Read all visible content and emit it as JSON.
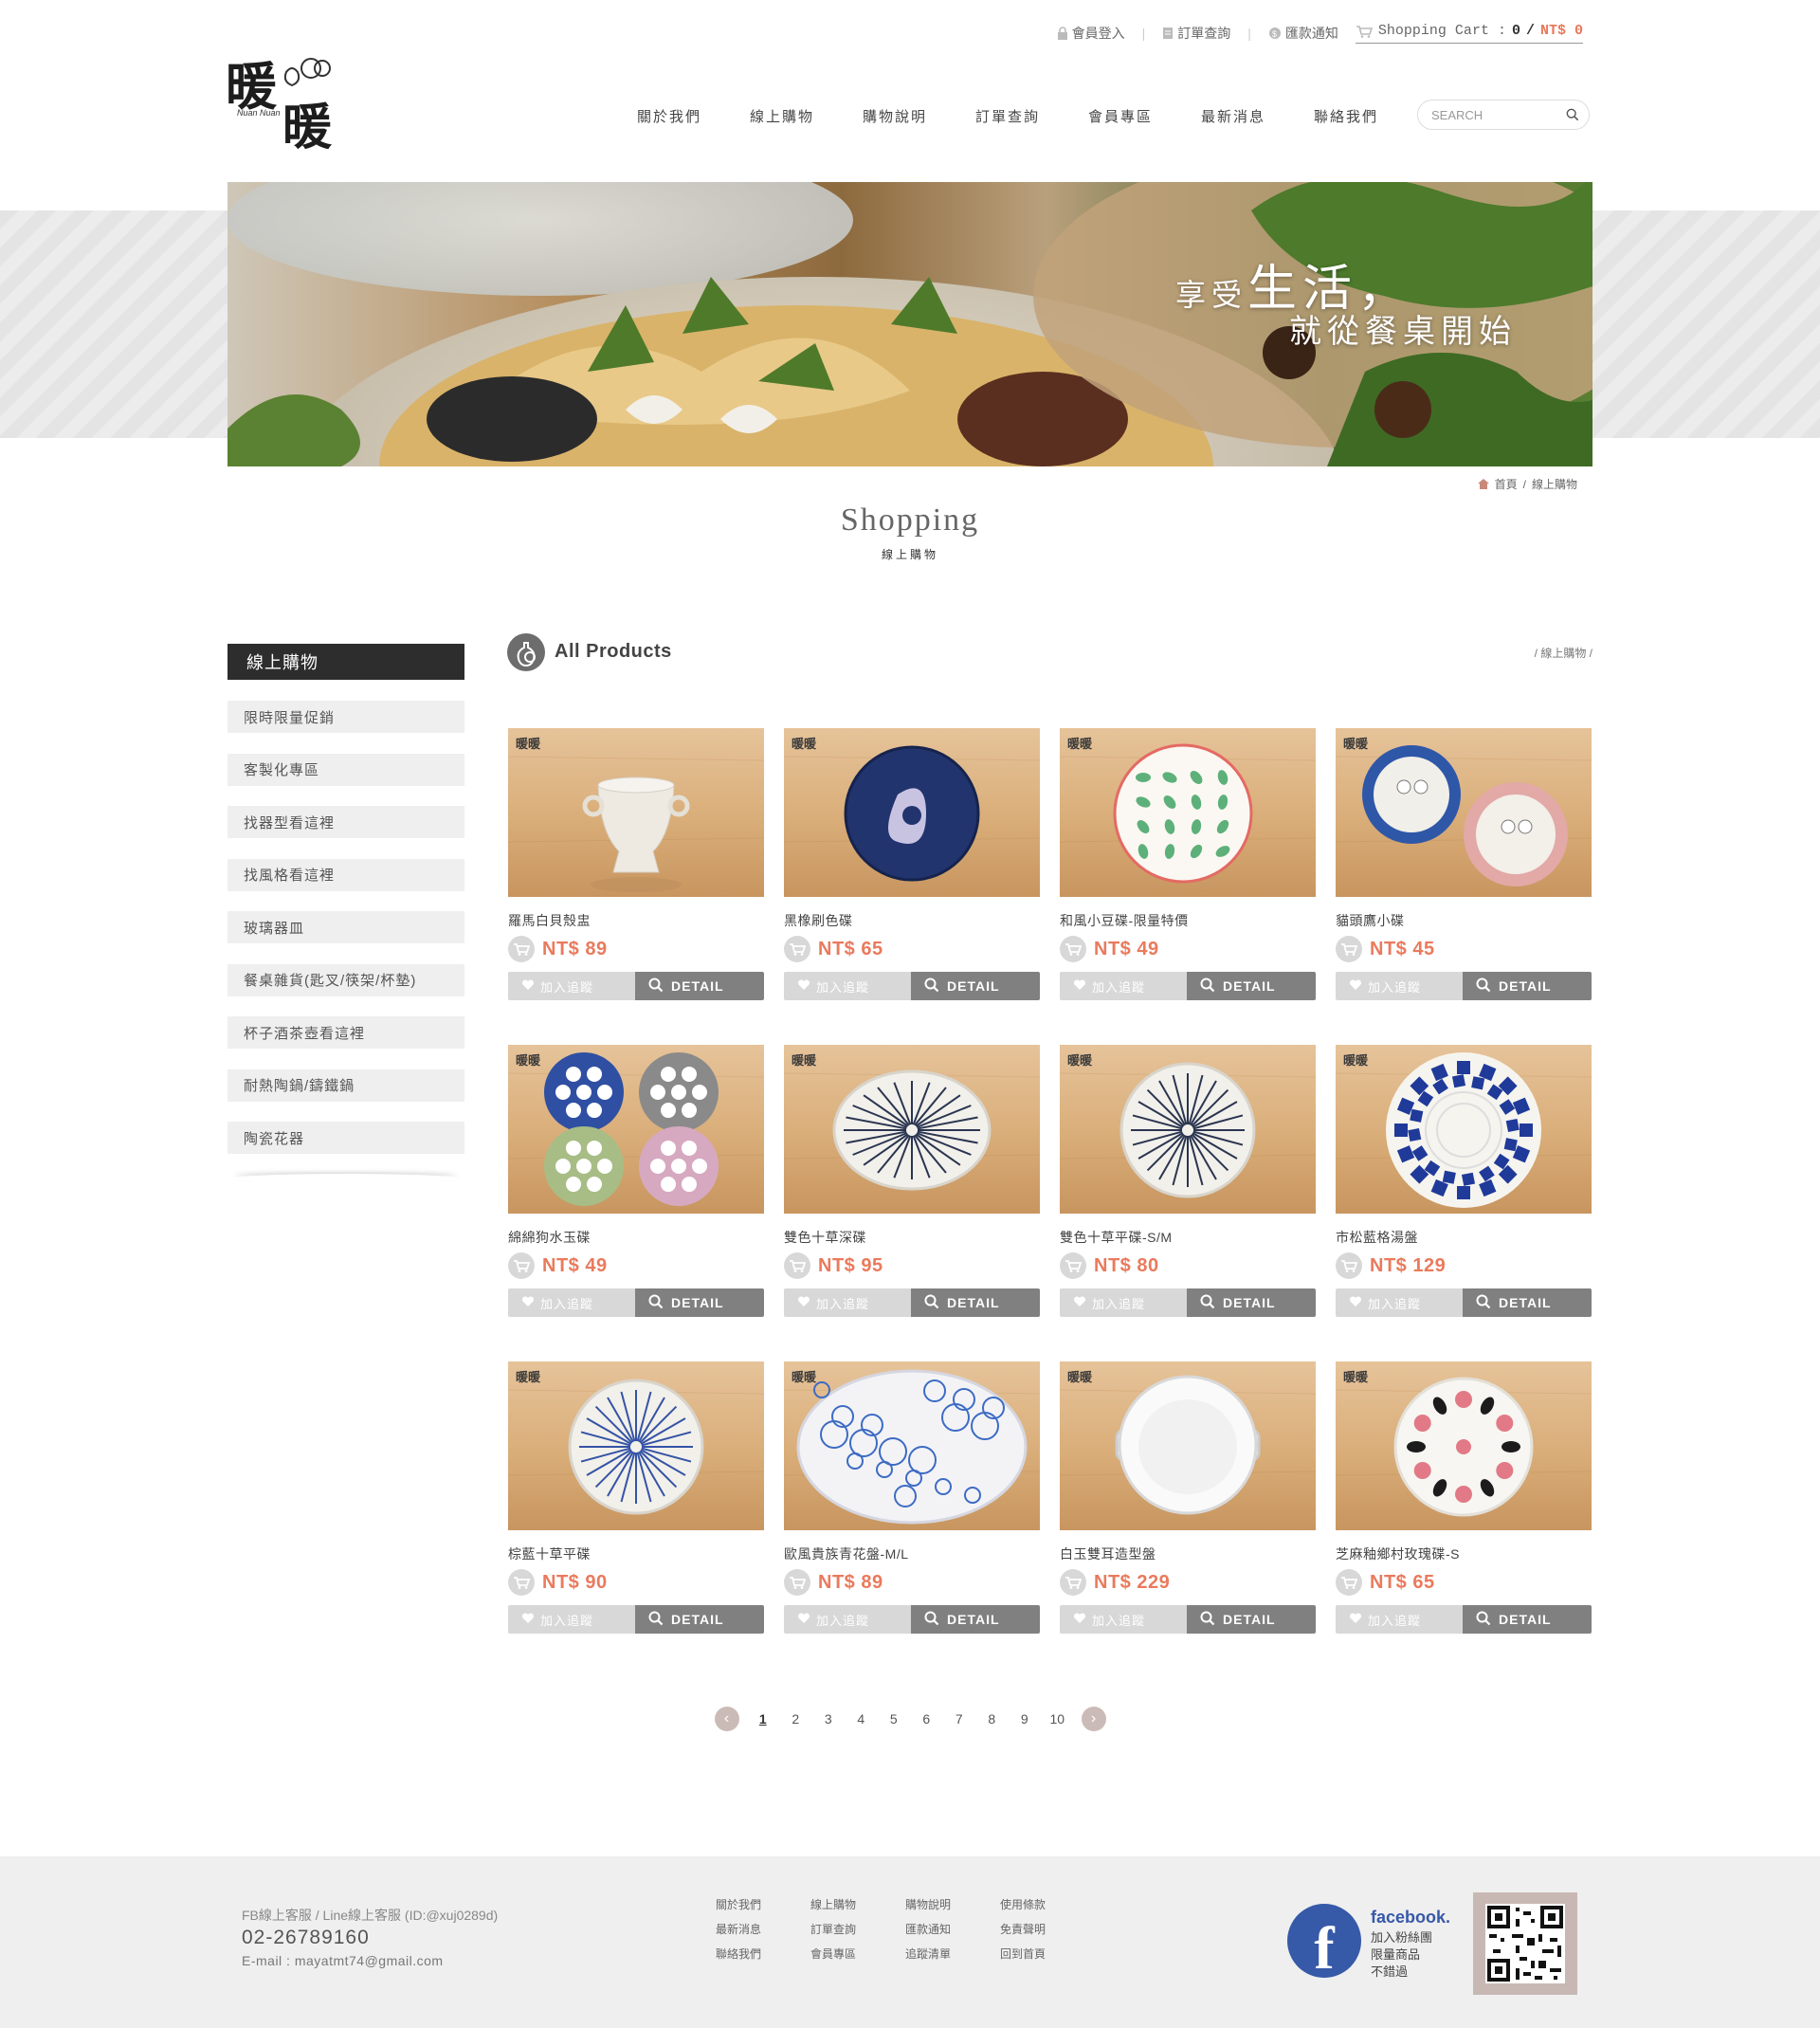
{
  "header": {
    "logo_text": "暖暖",
    "topbar": {
      "member_login": "會員登入",
      "order_query": "訂單查詢",
      "remit_notice": "匯款通知",
      "cart_label": "Shopping Cart :",
      "cart_count": "0",
      "cart_slash": "/",
      "cart_total": "NT$ 0"
    },
    "nav": [
      "關於我們",
      "線上購物",
      "購物說明",
      "訂單查詢",
      "會員專區",
      "最新消息",
      "聯絡我們"
    ],
    "search_placeholder": "SEARCH"
  },
  "banner": {
    "line1_prefix": "享受",
    "line1_big": "生活，",
    "line2": "就從餐桌開始"
  },
  "breadcrumb": {
    "home": "首頁",
    "sep": "/",
    "current": "線上購物"
  },
  "page": {
    "title": "Shopping",
    "subtitle": "線上購物"
  },
  "sidebar": {
    "title": "線上購物",
    "items": [
      "限時限量促銷",
      "客製化專區",
      "找器型看這裡",
      "找風格看這裡",
      "玻璃器皿",
      "餐桌雜貨(匙叉/筷架/杯墊)",
      "杯子酒茶壺看這裡",
      "耐熱陶鍋/鑄鐵鍋",
      "陶瓷花器"
    ]
  },
  "products_section": {
    "title": "All Products",
    "crumb": "/ 線上購物 /"
  },
  "product_brand": "暖暖",
  "buttons": {
    "favorite": "加入追蹤",
    "detail": "DETAIL"
  },
  "products": [
    {
      "name": "羅馬白貝殼盅",
      "price": "NT$ 89",
      "art": "cup"
    },
    {
      "name": "黑橡刷色碟",
      "price": "NT$ 65",
      "art": "navy"
    },
    {
      "name": "和風小豆碟-限量特價",
      "price": "NT$ 49",
      "art": "beans"
    },
    {
      "name": "貓頭鷹小碟",
      "price": "NT$ 45",
      "art": "owl"
    },
    {
      "name": "綿綿狗水玉碟",
      "price": "NT$ 49",
      "art": "dots"
    },
    {
      "name": "雙色十草深碟",
      "price": "NT$ 95",
      "art": "tokusa"
    },
    {
      "name": "雙色十草平碟-S/M",
      "price": "NT$ 80",
      "art": "tokusa2"
    },
    {
      "name": "市松藍格湯盤",
      "price": "NT$ 129",
      "art": "check"
    },
    {
      "name": "棕藍十草平碟",
      "price": "NT$ 90",
      "art": "blueline"
    },
    {
      "name": "歐風貴族青花盤-M/L",
      "price": "NT$ 89",
      "art": "toile"
    },
    {
      "name": "白玉雙耳造型盤",
      "price": "NT$ 229",
      "art": "handle"
    },
    {
      "name": "芝麻釉鄉村玫瑰碟-S",
      "price": "NT$ 65",
      "art": "rose"
    }
  ],
  "pagination": {
    "pages": [
      "1",
      "2",
      "3",
      "4",
      "5",
      "6",
      "7",
      "8",
      "9",
      "10"
    ],
    "current": "1",
    "prev": "‹",
    "next": "›"
  },
  "footer": {
    "service": "FB線上客服 / Line線上客服 (ID:@xuj0289d)",
    "phone": "02-26789160",
    "email": "E-mail : mayatmt74@gmail.com",
    "links": [
      "關於我們",
      "線上購物",
      "購物說明",
      "使用條款",
      "最新消息",
      "訂單查詢",
      "匯款通知",
      "免責聲明",
      "聯絡我們",
      "會員專區",
      "追蹤清單",
      "回到首頁"
    ],
    "facebook_word": "facebook.",
    "facebook_lines": [
      "加入粉絲團",
      "限量商品",
      "不錯過"
    ]
  },
  "colors": {
    "price": "#ea7a5c",
    "dark": "#2d2d2d",
    "footer_bg": "#efefef",
    "detail_btn": "#808080"
  }
}
